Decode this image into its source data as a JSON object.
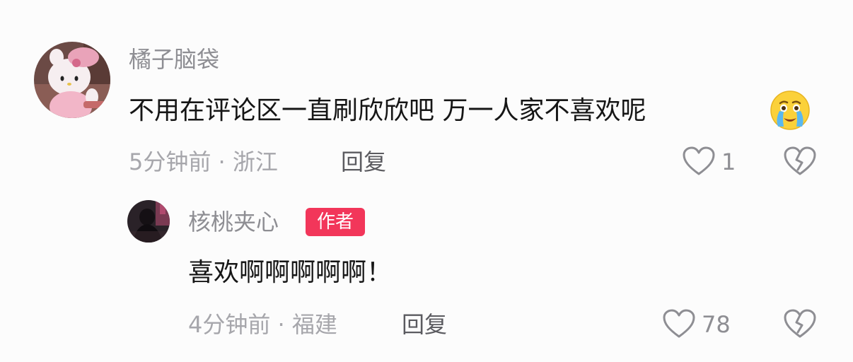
{
  "comment": {
    "username": "橘子脑袋",
    "text": "不用在评论区一直刷欣欣吧 万一人家不喜欢呢",
    "emoji": "crying-face-emoji",
    "meta": "5分钟前 · 浙江",
    "reply_label": "回复",
    "like_count": "1",
    "avatar": "hello-kitty-avatar"
  },
  "reply": {
    "username": "核桃夹心",
    "badge": "作者",
    "text": "喜欢啊啊啊啊啊！",
    "meta": "4分钟前 · 福建",
    "reply_label": "回复",
    "like_count": "78",
    "avatar": "dark-portrait-avatar"
  },
  "colors": {
    "badge": "#f2365a",
    "username": "#8e8e93",
    "meta": "#a6a6ab",
    "text": "#161616",
    "background": "#fcfcfc"
  }
}
